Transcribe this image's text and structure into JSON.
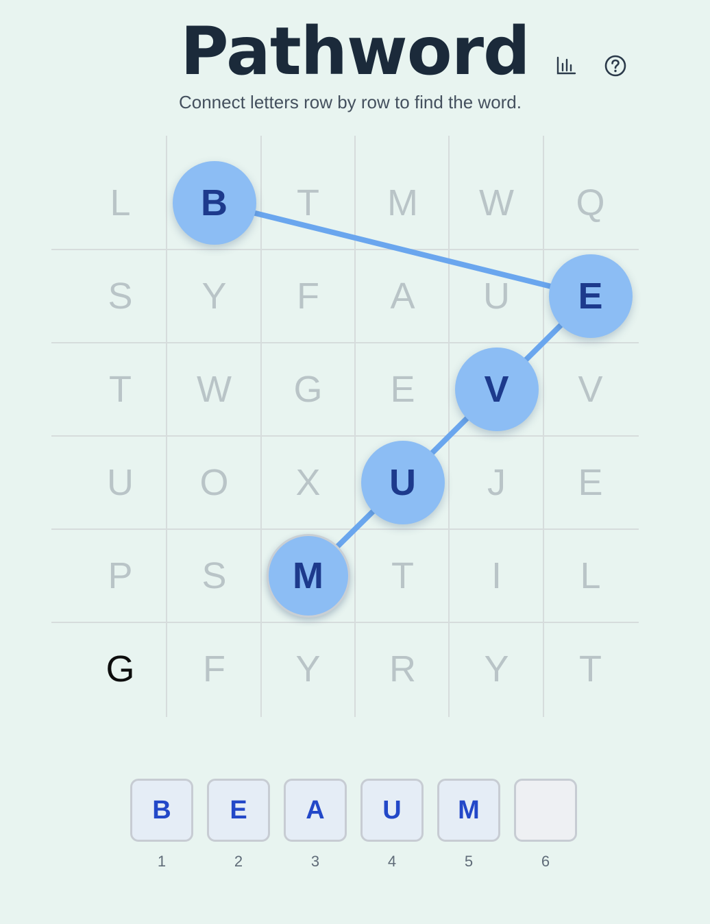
{
  "header": {
    "title": "Pathword",
    "subtitle": "Connect letters row by row to find the word.",
    "stats_icon": "bar-chart-icon",
    "help_icon": "question-circle-icon"
  },
  "colors": {
    "background": "#e8f4f0",
    "bubble": "#8cbdf4",
    "path_line": "#6aa6ee",
    "selected_letter": "#1d3a8c",
    "inactive_letter": "#b9c4c7",
    "slot_letter": "#2348c8"
  },
  "grid": {
    "rows": [
      [
        "L",
        "B",
        "T",
        "M",
        "W",
        "Q"
      ],
      [
        "S",
        "Y",
        "F",
        "A",
        "U",
        "E"
      ],
      [
        "T",
        "W",
        "G",
        "E",
        "V",
        "V"
      ],
      [
        "U",
        "O",
        "X",
        "U",
        "J",
        "E"
      ],
      [
        "P",
        "S",
        "M",
        "T",
        "I",
        "L"
      ],
      [
        "G",
        "F",
        "Y",
        "R",
        "Y",
        "T"
      ]
    ],
    "path": [
      [
        0,
        1
      ],
      [
        1,
        5
      ],
      [
        2,
        4
      ],
      [
        3,
        3
      ],
      [
        4,
        2
      ]
    ],
    "current": [
      4,
      2
    ],
    "available": [
      [
        5,
        0
      ]
    ]
  },
  "answer": {
    "slots": [
      {
        "letter": "B",
        "number": "1"
      },
      {
        "letter": "E",
        "number": "2"
      },
      {
        "letter": "A",
        "number": "3"
      },
      {
        "letter": "U",
        "number": "4"
      },
      {
        "letter": "M",
        "number": "5"
      },
      {
        "letter": "",
        "number": "6"
      }
    ]
  }
}
